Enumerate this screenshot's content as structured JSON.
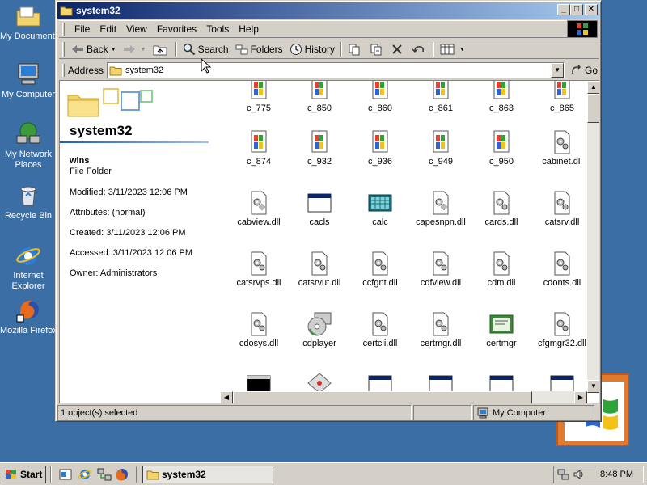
{
  "desktop": {
    "icons": [
      {
        "label": "My Documents",
        "icon": "folder-documents-icon"
      },
      {
        "label": "My Computer",
        "icon": "computer-icon"
      },
      {
        "label": "My Network Places",
        "icon": "network-icon"
      },
      {
        "label": "Recycle Bin",
        "icon": "recycle-bin-icon"
      },
      {
        "label": "Internet Explorer",
        "icon": "internet-explorer-icon"
      },
      {
        "label": "Mozilla Firefox",
        "icon": "firefox-icon"
      }
    ]
  },
  "window": {
    "title": "system32",
    "menu": [
      "File",
      "Edit",
      "View",
      "Favorites",
      "Tools",
      "Help"
    ],
    "toolbar": {
      "back": "Back",
      "search": "Search",
      "folders": "Folders",
      "history": "History"
    },
    "address": {
      "label": "Address",
      "value": "system32",
      "go": "Go"
    },
    "details": {
      "folder_name": "system32",
      "selected_name": "wins",
      "selected_type": "File Folder",
      "modified": "Modified: 3/11/2023 12:06 PM",
      "attributes": "Attributes: (normal)",
      "created": "Created: 3/11/2023 12:06 PM",
      "accessed": "Accessed: 3/11/2023 12:06 PM",
      "owner": "Owner: Administrators"
    },
    "files": [
      {
        "name": "c_775",
        "icon": "nls-file-icon"
      },
      {
        "name": "c_850",
        "icon": "nls-file-icon"
      },
      {
        "name": "c_860",
        "icon": "nls-file-icon"
      },
      {
        "name": "c_861",
        "icon": "nls-file-icon"
      },
      {
        "name": "c_863",
        "icon": "nls-file-icon"
      },
      {
        "name": "c_865",
        "icon": "nls-file-icon"
      },
      {
        "name": "c_874",
        "icon": "nls-file-icon"
      },
      {
        "name": "c_932",
        "icon": "nls-file-icon"
      },
      {
        "name": "c_936",
        "icon": "nls-file-icon"
      },
      {
        "name": "c_949",
        "icon": "nls-file-icon"
      },
      {
        "name": "c_950",
        "icon": "nls-file-icon"
      },
      {
        "name": "cabinet.dll",
        "icon": "dll-icon"
      },
      {
        "name": "cabview.dll",
        "icon": "dll-icon"
      },
      {
        "name": "cacls",
        "icon": "window-app-icon"
      },
      {
        "name": "calc",
        "icon": "calculator-icon"
      },
      {
        "name": "capesnpn.dll",
        "icon": "dll-icon"
      },
      {
        "name": "cards.dll",
        "icon": "dll-icon"
      },
      {
        "name": "catsrv.dll",
        "icon": "dll-icon"
      },
      {
        "name": "catsrvps.dll",
        "icon": "dll-icon"
      },
      {
        "name": "catsrvut.dll",
        "icon": "dll-icon"
      },
      {
        "name": "ccfgnt.dll",
        "icon": "dll-icon"
      },
      {
        "name": "cdfview.dll",
        "icon": "dll-icon"
      },
      {
        "name": "cdm.dll",
        "icon": "dll-icon"
      },
      {
        "name": "cdonts.dll",
        "icon": "dll-icon"
      },
      {
        "name": "cdosys.dll",
        "icon": "dll-icon"
      },
      {
        "name": "cdplayer",
        "icon": "cd-player-icon"
      },
      {
        "name": "certcli.dll",
        "icon": "dll-icon"
      },
      {
        "name": "certmgr.dll",
        "icon": "dll-icon"
      },
      {
        "name": "certmgr",
        "icon": "certificate-icon"
      },
      {
        "name": "cfgmgr32.dll",
        "icon": "dll-icon"
      },
      {
        "name": "",
        "icon": "console-icon"
      },
      {
        "name": "",
        "icon": "diamond-app-icon"
      },
      {
        "name": "",
        "icon": "window-app-icon"
      },
      {
        "name": "",
        "icon": "window-app-icon"
      },
      {
        "name": "",
        "icon": "window-app-icon"
      },
      {
        "name": "",
        "icon": "window-app-icon"
      }
    ],
    "status": {
      "selection": "1 object(s) selected",
      "zone": "My Computer"
    }
  },
  "taskbar": {
    "start": "Start",
    "task": "system32",
    "clock": "8:48 PM"
  },
  "colors": {
    "desktop": "#3a6ea5",
    "titlebar_start": "#0a246a",
    "titlebar_end": "#a6caf0",
    "chrome": "#d4d0c8"
  }
}
